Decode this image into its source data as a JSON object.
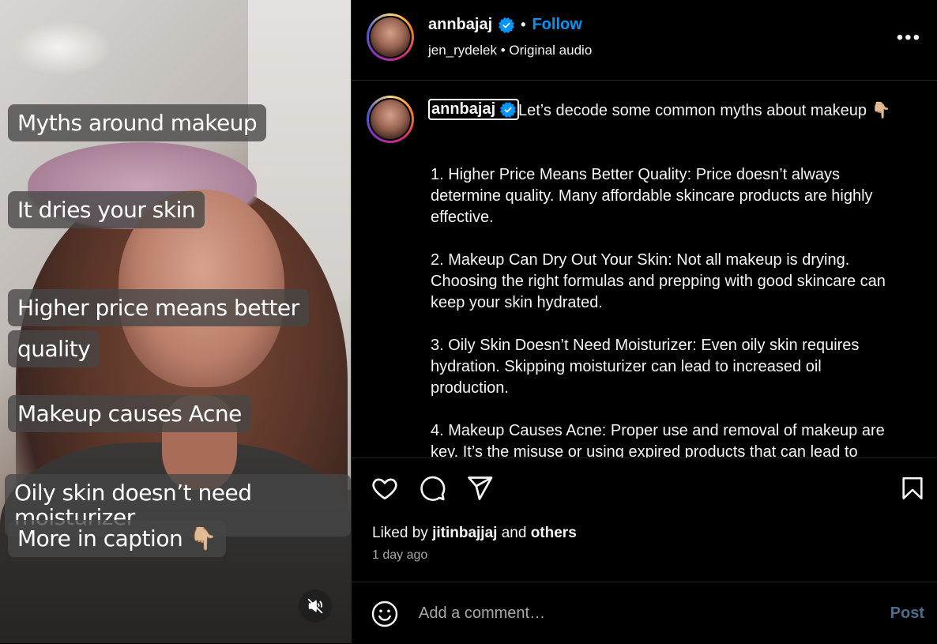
{
  "video": {
    "captions": [
      "Myths around makeup",
      "It dries your skin",
      "Higher price means better",
      "quality",
      "Makeup causes Acne",
      "Oily skin doesn’t need moisturizer",
      "More in caption 👇🏼"
    ],
    "mute_icon": "speaker-muted-icon"
  },
  "header": {
    "username": "annbajaj",
    "separator": "•",
    "follow": "Follow",
    "audio_user": "jen_rydelek",
    "audio_label": "Original audio",
    "more_label": "•••"
  },
  "caption": {
    "username": "annbajaj",
    "intro": "Let’s decode some common myths about makeup 👇🏼",
    "items": [
      "1. Higher Price Means Better Quality: Price doesn’t always determine quality. Many affordable skincare products are highly effective.",
      "2. Makeup Can Dry Out Your Skin: Not all makeup is drying. Choosing the right formulas and prepping with good skincare can keep your skin hydrated.",
      "3. Oily Skin Doesn’t Need Moisturizer: Even oily skin requires hydration. Skipping moisturizer can lead to increased oil production.",
      "4. Makeup Causes Acne: Proper use and removal of makeup are key. It’s the misuse or using expired products that can lead to"
    ]
  },
  "actions": {
    "liked_prefix": "Liked by",
    "liked_user": "jitinbajjaj",
    "liked_and": "and",
    "liked_others": "others",
    "time_ago": "1 day ago"
  },
  "comment": {
    "placeholder": "Add a comment…",
    "post": "Post"
  },
  "colors": {
    "background": "#000000",
    "accent_blue": "#0095f6",
    "muted_text": "#a8a8a8",
    "post_disabled": "#4a6d8c"
  }
}
